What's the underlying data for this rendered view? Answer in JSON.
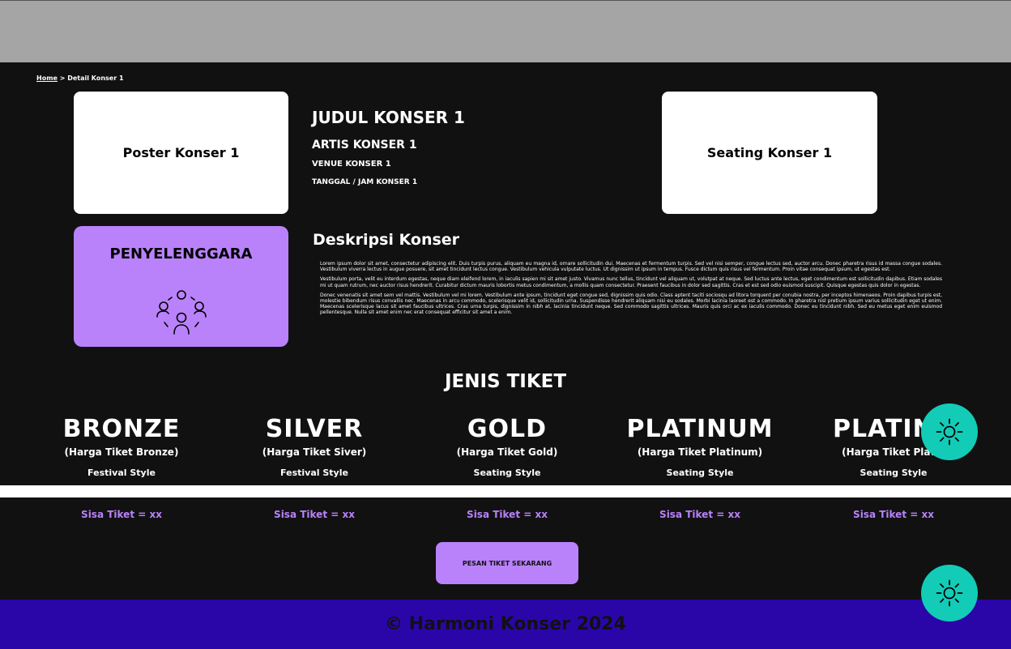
{
  "breadcrumb": {
    "home": "Home",
    "separator": " > ",
    "current": "Detail Konser 1"
  },
  "poster": {
    "label": "Poster Konser 1"
  },
  "seating": {
    "label": "Seating Konser 1"
  },
  "concert": {
    "title": "JUDUL KONSER 1",
    "artist": "ARTIS KONSER 1",
    "venue": "VENUE KONSER 1",
    "datetime": "TANGGAL / JAM KONSER 1"
  },
  "organizer": {
    "label": "PENYELENGGARA",
    "icon": "group-icon"
  },
  "description": {
    "title": "Deskripsi Konser",
    "paragraphs": [
      "Lorem ipsum dolor sit amet, consectetur adipiscing elit. Duis turpis purus, aliquam eu magna id, ornare sollicitudin dui. Maecenas et fermentum turpis. Sed vel nisi semper, congue lectus sed, auctor arcu. Donec pharetra risus id massa congue sodales. Vestibulum viverra lectus in augue posuere, sit amet tincidunt lectus congue. Vestibulum vehicula vulputate luctus. Ut dignissim ut ipsum in tempus. Fusce dictum quis risus vel fermentum. Proin vitae consequat ipsum, ut egestas est.",
      "Vestibulum porta, velit eu interdum egestas, neque diam eleifend lorem, in iaculis sapien mi sit amet justo. Vivamus nunc tellus, tincidunt vel aliquam ut, volutpat at neque. Sed luctus ante lectus, eget condimentum est sollicitudin dapibus. Etiam sodales mi ut quam rutrum, nec auctor risus hendrerit. Curabitur dictum mauris lobortis metus condimentum, a mollis quam consectetur. Praesent faucibus in dolor sed sagittis. Cras et est sed odio euismod suscipit. Quisque egestas quis dolor in egestas.",
      "Donec venenatis sit amet sem vel mattis. Vestibulum vel mi lorem. Vestibulum ante ipsum, tincidunt eget congue sed, dignissim quis odio. Class aptent taciti sociosqu ad litora torquent per conubia nostra, per inceptos himenaeos. Proin dapibus turpis est, molestie bibendum risus convallis nec. Maecenas in arcu commodo, scelerisque velit id, sollicitudin urna. Suspendisse hendrerit aliquam nisi eu sodales. Morbi lacinia laoreet est a commodo. In pharetra nisl pretium ipsum varius sollicitudin eget ut enim. Maecenas scelerisque lacus sit amet faucibus ultrices. Cras urna turpis, dignissim in nibh at, lacinia tincidunt neque. Sed commodo sagittis ultrices. Mauris quis orci ac ex iaculis commodo. Donec eu tincidunt nibh. Sed eu metus eget enim euismod pellentesque. Nulla sit amet enim nec erat consequat efficitur sit amet a enim."
    ]
  },
  "tickets": {
    "heading": "JENIS TIKET",
    "tiers": [
      {
        "name": "BRONZE",
        "price": "(Harga Tiket Bronze)",
        "style": "Festival Style",
        "remaining": "Sisa Tiket = xx"
      },
      {
        "name": "SILVER",
        "price": "(Harga Tiket Siver)",
        "style": "Festival Style",
        "remaining": "Sisa Tiket = xx"
      },
      {
        "name": "GOLD",
        "price": "(Harga Tiket Gold)",
        "style": "Seating Style",
        "remaining": "Sisa Tiket = xx"
      },
      {
        "name": "PLATINUM",
        "price": "(Harga Tiket Platinum)",
        "style": "Seating Style",
        "remaining": "Sisa Tiket = xx"
      },
      {
        "name": "PLATINU",
        "price": "(Harga Tiket Platin",
        "style": "Seating Style",
        "remaining": "Sisa Tiket = xx"
      }
    ]
  },
  "book_button": {
    "label": "PESAN TIKET SEKARANG"
  },
  "footer": {
    "copyright": "© Harmoni Konser 2024"
  },
  "theme_toggle": {
    "icon": "sun-icon"
  },
  "colors": {
    "accent": "#b982fb",
    "footer": "#2a06a8",
    "toggle": "#12ccb7",
    "topbar": "#a5a5a5",
    "background": "#111111"
  }
}
